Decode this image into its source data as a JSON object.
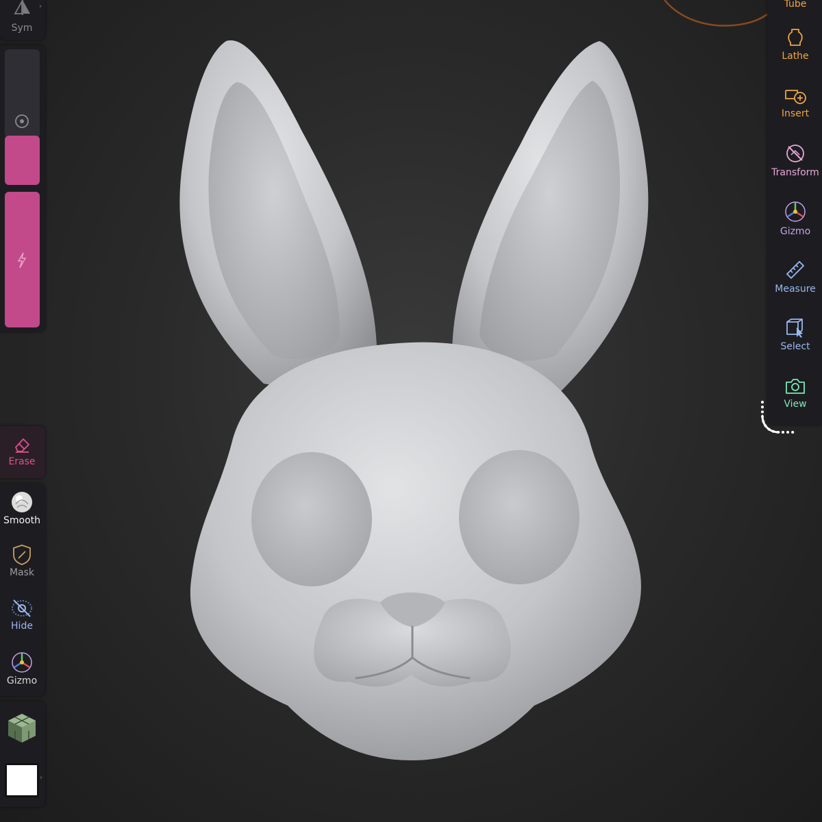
{
  "left_top": {
    "sym_label": "Sym"
  },
  "sliders": {
    "radius_color": "#c2498a",
    "intensity_color": "#c2498a"
  },
  "left_tools": {
    "erase": {
      "label": "Erase",
      "color": "#e0508f"
    },
    "smooth": {
      "label": "Smooth"
    },
    "mask": {
      "label": "Mask"
    },
    "hide": {
      "label": "Hide"
    },
    "gizmo": {
      "label": "Gizmo"
    }
  },
  "right_tools": [
    {
      "id": "tube",
      "label": "Tube",
      "icon": "tube-icon",
      "color": "#f0a640"
    },
    {
      "id": "lathe",
      "label": "Lathe",
      "icon": "lathe-icon",
      "color": "#f0a640"
    },
    {
      "id": "insert",
      "label": "Insert",
      "icon": "insert-icon",
      "color": "#f0a640"
    },
    {
      "id": "transform",
      "label": "Transform",
      "icon": "transform-icon",
      "color": "#e8a8d8"
    },
    {
      "id": "gizmo",
      "label": "Gizmo",
      "icon": "gizmo-icon",
      "color": "#c9a0e8"
    },
    {
      "id": "measure",
      "label": "Measure",
      "icon": "ruler-icon",
      "color": "#9ab8f0"
    },
    {
      "id": "select",
      "label": "Select",
      "icon": "select-box-icon",
      "color": "#9ab8f0"
    },
    {
      "id": "view",
      "label": "View",
      "icon": "camera-icon",
      "color": "#7ee8b8"
    }
  ]
}
